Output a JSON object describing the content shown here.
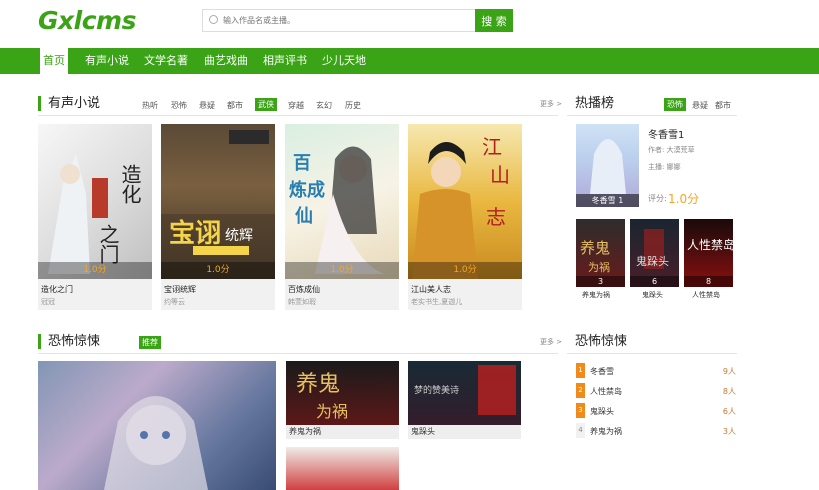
{
  "header": {
    "logo": "Gxlcms",
    "search_placeholder": "输入作品名或主播。",
    "search_button": "搜 索"
  },
  "nav": [
    "首页",
    "有声小说",
    "文学名著",
    "曲艺戏曲",
    "相声评书",
    "少儿天地"
  ],
  "section1": {
    "title": "有声小说",
    "categories": [
      "热听",
      "恐怖",
      "悬疑",
      "都市",
      "武侠",
      "穿越",
      "玄幻",
      "历史"
    ],
    "active_category": "武侠",
    "more": "更多 >",
    "cards": [
      {
        "title": "造化之门",
        "author": "冠冠",
        "score": "1.0分",
        "cover_text": "造化之门"
      },
      {
        "title": "宝诩统辉",
        "author": "约等云",
        "score": "1.0分",
        "cover_text": "宝诩统辉"
      },
      {
        "title": "百炼成仙",
        "author": "韩萱如瑕",
        "score": "1.0分",
        "cover_text": "百炼成仙"
      },
      {
        "title": "江山美人志",
        "author": "老实书生,夏迦儿",
        "score": "1.0分",
        "cover_text": "江山美人志"
      }
    ]
  },
  "hot": {
    "title": "热播榜",
    "tabs": [
      "恐怖",
      "悬疑",
      "都市"
    ],
    "active_tab": "恐怖",
    "featured": {
      "title": "冬香雪1",
      "author": "作者: 大漠荒草",
      "host": "主播: 娜娜",
      "score_label": "评分:",
      "score": "1.0分",
      "cover_label": "冬香雪",
      "cover_num": "1"
    },
    "small": [
      {
        "title": "养鬼为祸",
        "num": "3",
        "cover_text": "养鬼为祸"
      },
      {
        "title": "鬼跺头",
        "num": "6",
        "cover_text": "鬼跺头"
      },
      {
        "title": "人性禁岛",
        "num": "8",
        "cover_text": "人性禁岛"
      }
    ]
  },
  "section2": {
    "title": "恐怖惊悚",
    "tag": "推荐",
    "more": "更多 >",
    "cards": [
      {
        "title": "养鬼为祸",
        "cover_text": "养鬼为祸"
      },
      {
        "title": "鬼跺头",
        "cover_text": "鬼跺头"
      }
    ]
  },
  "rank2": {
    "title": "恐怖惊悚",
    "items": [
      {
        "num": "1",
        "name": "冬香雪",
        "count": "9人"
      },
      {
        "num": "2",
        "name": "人性禁岛",
        "count": "8人"
      },
      {
        "num": "3",
        "name": "鬼跺头",
        "count": "6人"
      },
      {
        "num": "4",
        "name": "养鬼为祸",
        "count": "3人"
      }
    ]
  },
  "colors": {
    "accent": "#3aa416",
    "score": "#f5a623"
  }
}
